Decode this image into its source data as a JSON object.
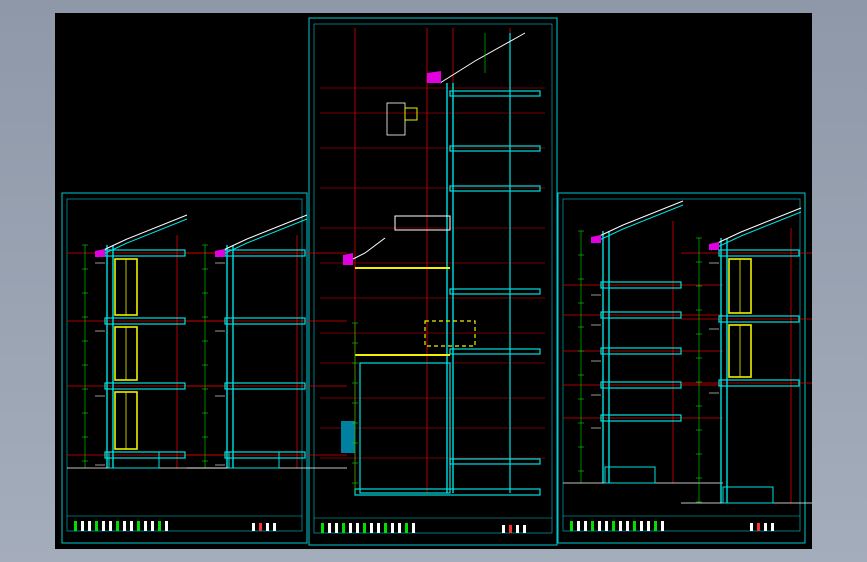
{
  "app": {
    "view": "cad-model-space"
  },
  "colors": {
    "background": "#000000",
    "frame": "#00c8d0",
    "grid": "#e00000",
    "wall": "#00e0e0",
    "window": "#f0f000",
    "roof": "#e000e0",
    "dim": "#00e000",
    "text": "#ffffff"
  },
  "sheets": [
    {
      "id": "left",
      "label": "section-sheet-left"
    },
    {
      "id": "center",
      "label": "section-sheet-center"
    },
    {
      "id": "right",
      "label": "section-sheet-right"
    }
  ]
}
